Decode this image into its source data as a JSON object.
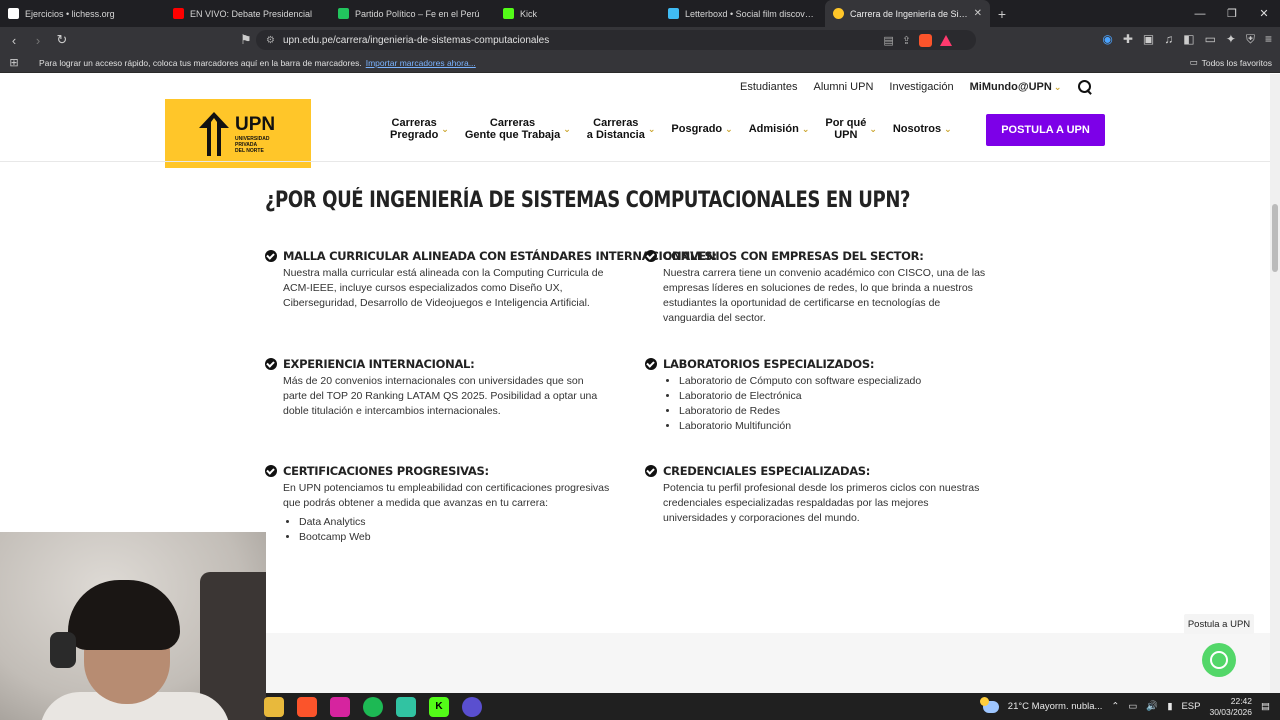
{
  "browser": {
    "tabs": [
      {
        "title": "Ejercicios • lichess.org",
        "color": "#ffffff"
      },
      {
        "title": "EN VIVO: Debate Presidencial",
        "color": "#ff0000"
      },
      {
        "title": "Partido Político – Fe en el Perú",
        "color": "#22c55e"
      },
      {
        "title": "Kick",
        "color": "#53fc18"
      },
      {
        "title": "Letterboxd • Social film discovery.",
        "color": "#40bcf4"
      },
      {
        "title": "Carrera de Ingeniería de Sistema",
        "color": "#ffc629",
        "active": true
      }
    ],
    "url": "upn.edu.pe/carrera/ingenieria-de-sistemas-computacionales",
    "bookmarks_text": "Para lograr un acceso rápido, coloca tus marcadores aquí en la barra de marcadores.",
    "bookmarks_link": "Importar marcadores ahora...",
    "all_favorites": "Todos los favoritos"
  },
  "topnav": {
    "items": [
      "Estudiantes",
      "Alumni UPN",
      "Investigación"
    ],
    "mimundo": "MiMundo@UPN"
  },
  "logo": {
    "name": "UPN",
    "sub": [
      "UNIVERSIDAD",
      "PRIVADA",
      "DEL NORTE"
    ],
    "accent": "#ffc629"
  },
  "mainnav": [
    {
      "line1": "Carreras",
      "line2": "Pregrado"
    },
    {
      "line1": "Carreras",
      "line2": "Gente que Trabaja"
    },
    {
      "line1": "Carreras",
      "line2": "a Distancia"
    },
    {
      "line1": "Posgrado",
      "line2": ""
    },
    {
      "line1": "Admisión",
      "line2": ""
    },
    {
      "line1": "Por qué",
      "line2": "UPN"
    },
    {
      "line1": "Nosotros",
      "line2": ""
    }
  ],
  "cta": {
    "label": "POSTULA A UPN",
    "color": "#7d00e8"
  },
  "heading": "¿POR QUÉ INGENIERÍA DE SISTEMAS COMPUTACIONALES EN UPN?",
  "features": [
    {
      "title": "MALLA CURRICULAR ALINEADA CON ESTÁNDARES INTERNACIONALES:",
      "body": "Nuestra malla curricular está alineada con la Computing Curricula de ACM-IEEE, incluye cursos especializados como Diseño UX, Ciberseguridad, Desarrollo de Videojuegos e Inteligencia Artificial.",
      "items": []
    },
    {
      "title": "CONVENIOS CON EMPRESAS DEL SECTOR:",
      "body": "Nuestra carrera tiene un convenio académico con CISCO, una de las empresas líderes en soluciones de redes, lo que brinda a nuestros estudiantes la oportunidad de certificarse en tecnologías de vanguardia del sector.",
      "items": []
    },
    {
      "title": "EXPERIENCIA INTERNACIONAL:",
      "body": "Más de 20 convenios internacionales con universidades que son parte del TOP 20 Ranking LATAM QS 2025. Posibilidad a optar una doble titulación e intercambios internacionales.",
      "items": []
    },
    {
      "title": "LABORATORIOS ESPECIALIZADOS:",
      "body": "",
      "items": [
        "Laboratorio de Cómputo con software especializado",
        "Laboratorio de Electrónica",
        "Laboratorio de Redes",
        "Laboratorio Multifunción"
      ]
    },
    {
      "title": "CERTIFICACIONES PROGRESIVAS:",
      "body": "En UPN potenciamos tu empleabilidad con certificaciones progresivas que podrás obtener a medida que avanzas en tu carrera:",
      "items": [
        "Data Analytics",
        "Bootcamp Web"
      ]
    },
    {
      "title": "CREDENCIALES ESPECIALIZADAS:",
      "body": "Potencia tu perfil profesional desde los primeros ciclos con nuestras credenciales especializadas respaldadas por las mejores universidades y corporaciones del mundo.",
      "items": []
    }
  ],
  "floating": {
    "postula": "Postula a UPN",
    "whatsapp_color": "#53d769"
  },
  "taskbar": {
    "weather": "21°C  Mayorm. nubla...",
    "lang": "ESP",
    "time": "22:42",
    "date": "30/03/2026"
  }
}
